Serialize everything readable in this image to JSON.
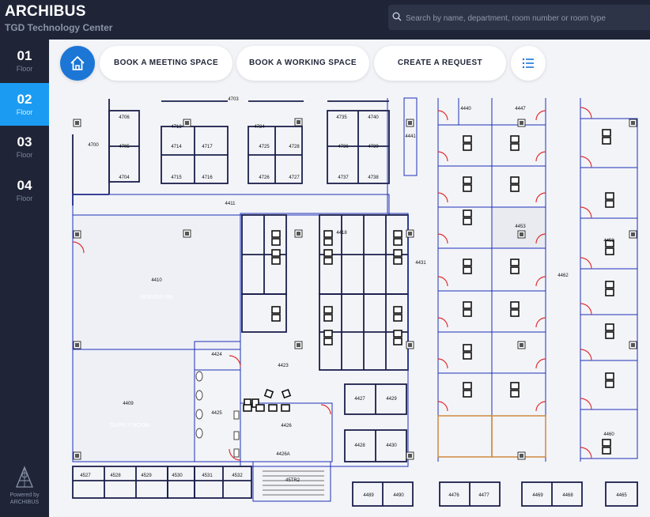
{
  "app": {
    "title": "ARCHIBUS",
    "subtitle": "TGD Technology Center"
  },
  "search": {
    "placeholder": "Search by name, department, room number or room type"
  },
  "floors": [
    {
      "num": "01",
      "label": "Floor"
    },
    {
      "num": "02",
      "label": "Floor"
    },
    {
      "num": "03",
      "label": "Floor"
    },
    {
      "num": "04",
      "label": "Floor"
    }
  ],
  "active_floor": "02",
  "footer": {
    "powered": "Powered by",
    "brand": "ARCHIBUS"
  },
  "actions": {
    "meeting": "BOOK A MEETING SPACE",
    "working": "BOOK A WORKING SPACE",
    "request": "CREATE A REQUEST"
  },
  "icons": {
    "home": "home-icon",
    "list": "list-icon",
    "search": "search-icon"
  },
  "colors": {
    "accent": "#1b9cf2",
    "sidebar": "#1f2537",
    "wall": "#1c2fb8",
    "door": "#e03030"
  },
  "plan": {
    "room_labels": [
      "4703",
      "4706",
      "4713",
      "4724",
      "4735",
      "4740",
      "4441",
      "4440",
      "4447",
      "4700",
      "4705",
      "4714",
      "4717",
      "4725",
      "4728",
      "4736",
      "4739",
      "4704",
      "4715",
      "4716",
      "4726",
      "4727",
      "4737",
      "4738",
      "4411",
      "4453",
      "4418",
      "4431",
      "4462",
      "4452",
      "4410",
      "4423",
      "4424",
      "4409",
      "4425",
      "4426",
      "4426A",
      "4427",
      "4429",
      "4428",
      "4430",
      "4460",
      "4527",
      "4528",
      "4529",
      "4530",
      "4531",
      "4532",
      "45TR2",
      "4489",
      "4490",
      "4476",
      "4477",
      "4469",
      "4468",
      "4465"
    ],
    "room_names": [
      "SERVER RM",
      "SUPPLY ROOM"
    ]
  }
}
